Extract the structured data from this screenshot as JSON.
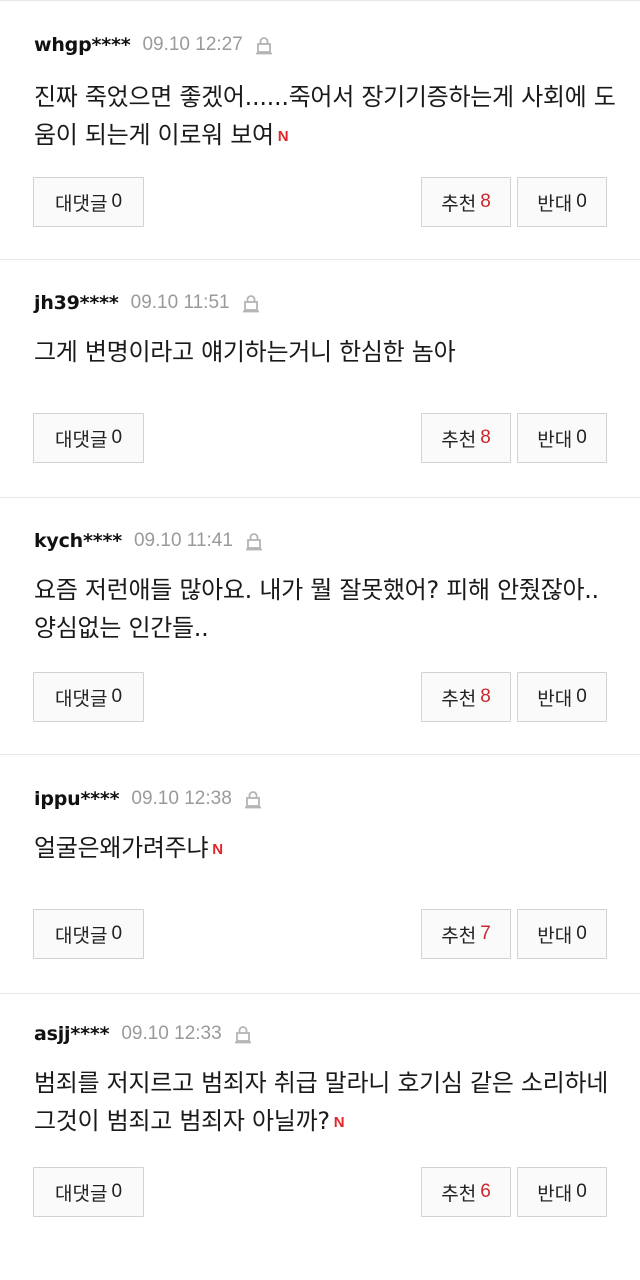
{
  "comments": [
    {
      "user": "whgp****",
      "date": "09.10 12:27",
      "text": "진짜 죽었으면 좋겠어......죽어서 장기기증하는게 사회에 도움이 되는게 이로워 보여",
      "has_new": true,
      "reply_label": "대댓글",
      "reply_count": "0",
      "like_label": "추천",
      "like_count": "8",
      "dislike_label": "반대",
      "dislike_count": "0"
    },
    {
      "user": "jh39****",
      "date": "09.10 11:51",
      "text": "그게 변명이라고 얘기하는거니 한심한 놈아",
      "has_new": false,
      "reply_label": "대댓글",
      "reply_count": "0",
      "like_label": "추천",
      "like_count": "8",
      "dislike_label": "반대",
      "dislike_count": "0"
    },
    {
      "user": "kych****",
      "date": "09.10 11:41",
      "text": "요즘 저런애들 많아요. 내가 뭘 잘못했어? 피해 안줬잖아.. 양심없는 인간들..",
      "has_new": false,
      "reply_label": "대댓글",
      "reply_count": "0",
      "like_label": "추천",
      "like_count": "8",
      "dislike_label": "반대",
      "dislike_count": "0"
    },
    {
      "user": "ippu****",
      "date": "09.10 12:38",
      "text": "얼굴은왜가려주냐",
      "has_new": true,
      "reply_label": "대댓글",
      "reply_count": "0",
      "like_label": "추천",
      "like_count": "7",
      "dislike_label": "반대",
      "dislike_count": "0"
    },
    {
      "user": "asjj****",
      "date": "09.10 12:33",
      "text": "범죄를 저지르고 범죄자 취급 말라니 호기심 같은 소리하네 그것이 범죄고 범죄자 아닐까?",
      "has_new": true,
      "reply_label": "대댓글",
      "reply_count": "0",
      "like_label": "추천",
      "like_count": "6",
      "dislike_label": "반대",
      "dislike_count": "0"
    }
  ],
  "new_badge": "N",
  "colors": {
    "accent_red": "#c8282d",
    "new_badge": "#e0262b",
    "muted": "#9a9a9a"
  }
}
